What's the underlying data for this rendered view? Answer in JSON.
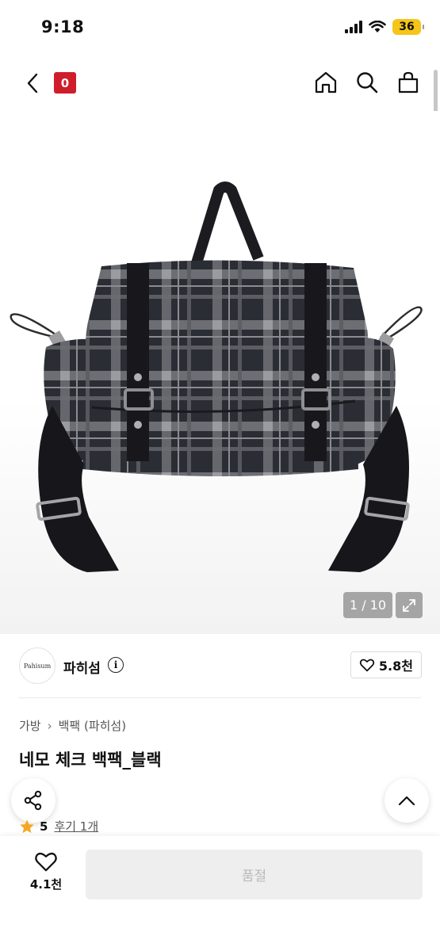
{
  "status_bar": {
    "time": "9:18",
    "battery": "36"
  },
  "header": {
    "cart_count": "0"
  },
  "image": {
    "counter": "1 / 10"
  },
  "brand": {
    "logo_text": "Pahisum",
    "name": "파히섬",
    "likes": "5.8천"
  },
  "breadcrumb": {
    "items": [
      "가방",
      "백팩 (파히섬)"
    ]
  },
  "product": {
    "title": "네모 체크 백팩_블랙",
    "rating": "5",
    "review_label": "후기 1개"
  },
  "bottom_bar": {
    "wish_count": "4.1천",
    "buy_label": "품절"
  },
  "colors": {
    "brand_red": "#cf1d2b",
    "star": "#f5a623",
    "battery": "#f5c518"
  },
  "icons": [
    "back-arrow-icon",
    "home-icon",
    "search-icon",
    "shopping-bag-icon",
    "expand-icon",
    "info-icon",
    "heart-icon",
    "share-icon",
    "chevron-up-icon",
    "star-icon"
  ]
}
